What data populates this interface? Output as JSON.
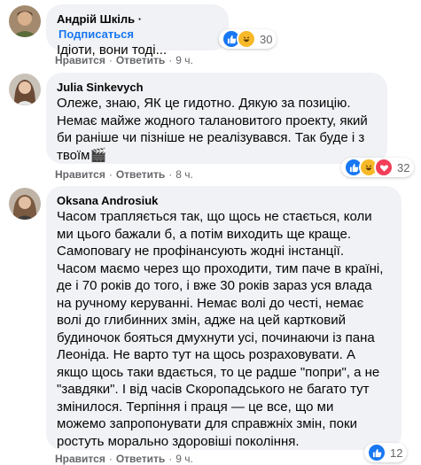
{
  "comments": [
    {
      "author": "Андрій Шкіль",
      "follow_label": "Подписаться",
      "text": "Ідіоти, вони тоді...",
      "like_label": "Нравится",
      "reply_label": "Ответить",
      "time": "9 ч.",
      "reaction_icons": [
        "like-icon",
        "haha-icon"
      ],
      "reaction_count": "30"
    },
    {
      "author": "Julia Sinkevych",
      "text": "Олеже, знаю, ЯК це гидотно. Дякую за позицію.\nНемає майже жодного талановитого проекту, який\nби раніше чи пізніше не реалізувався. Так буде і з\nтвоїм🎬",
      "like_label": "Нравится",
      "reply_label": "Ответить",
      "time": "8 ч.",
      "reaction_icons": [
        "like-icon",
        "haha-icon",
        "love-icon"
      ],
      "reaction_count": "32"
    },
    {
      "author": "Oksana Androsiuk",
      "text": "Часом трапляється так, що щось не стається, коли\nми цього бажали б, а потім виходить ще краще.\nСамоповагу не профінансують жодні інстанції.\nЧасом маємо через що проходити, тим паче в країні,\nде і 70 років до того, і вже 30 років зараз уся влада\nна ручному керуванні. Немає волі до честі, немає\nволі до глибинних змін, адже на цей картковий\nбудиночок бояться дмухнути усі, починаючи із пана\nЛеоніда. Не варто тут на щось розраховувати. А\nякщо щось таки вдається, то це радше \"попри\", а не\n\"завдяки\". І від часів Скоропадського не багато тут\nзмінилося. Терпіння і праця — це все, що ми\nможемо запропонувати для справжніх змін, поки\nростуть морально здоровіші покоління.",
      "like_label": "Нравится",
      "reply_label": "Ответить",
      "time": "9 ч.",
      "reaction_icons": [
        "like-icon"
      ],
      "reaction_count": "12"
    }
  ],
  "colors": {
    "bubble": "#f0f2f5",
    "link": "#1877f2",
    "secondary_text": "#65676b",
    "like": "#1877f2",
    "haha": "#f7b928",
    "love": "#f33e58"
  }
}
